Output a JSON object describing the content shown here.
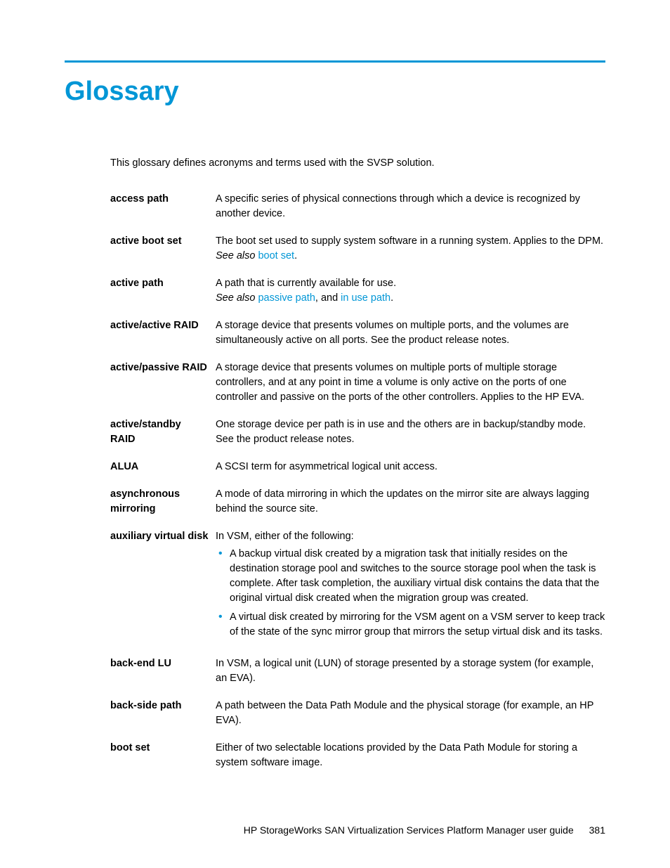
{
  "title": "Glossary",
  "intro": "This glossary defines acronyms and terms used with the SVSP solution.",
  "entries": {
    "access_path": {
      "term": "access path",
      "def": "A specific series of physical connections through which a device is recognized by another device."
    },
    "active_boot_set": {
      "term": "active boot set",
      "def": "The boot set used to supply system software in a running system. Applies to the DPM.",
      "see_also_prefix": "See also ",
      "see_also_link": "boot set",
      "see_also_suffix": "."
    },
    "active_path": {
      "term": "active path",
      "def": "A path that is currently available for use.",
      "see_also_prefix": "See also ",
      "see_also_link1": "passive path",
      "see_also_mid": ", and ",
      "see_also_link2": "in use path",
      "see_also_suffix": "."
    },
    "active_active_raid": {
      "term": "active/active RAID",
      "def": "A storage device that presents volumes on multiple ports, and the volumes are simultaneously active on all ports. See the product release notes."
    },
    "active_passive_raid": {
      "term": "active/passive RAID",
      "def": "A storage device that presents volumes on multiple ports of multiple storage controllers, and at any point in time a volume is only active on the ports of one controller and passive on the ports of the other controllers. Applies to the HP EVA."
    },
    "active_standby_raid": {
      "term": "active/standby RAID",
      "def": "One storage device per path is in use and the others are in backup/standby mode. See the product release notes."
    },
    "alua": {
      "term": "ALUA",
      "def": "A SCSI term for asymmetrical logical unit access."
    },
    "async_mirroring": {
      "term": "asynchronous mirroring",
      "def": "A mode of data mirroring in which the updates on the mirror site are always lagging behind the source site."
    },
    "aux_vdisk": {
      "term": "auxiliary virtual disk",
      "lead": "In VSM, either of the following:",
      "b1": "A backup virtual disk created by a migration task that initially resides on the destination storage pool and switches to the source storage pool when the task is complete. After task completion, the auxiliary virtual disk contains the data that the original virtual disk created when the migration group was created.",
      "b2": "A virtual disk created by mirroring for the VSM agent on a VSM server to keep track of the state of the sync mirror group that mirrors the setup virtual disk and its tasks."
    },
    "back_end_lu": {
      "term": "back-end LU",
      "def": "In VSM, a logical unit (LUN) of storage presented by a storage system (for example, an EVA)."
    },
    "back_side_path": {
      "term": "back-side path",
      "def": "A path between the Data Path Module and the physical storage (for example, an HP EVA)."
    },
    "boot_set": {
      "term": "boot set",
      "def": "Either of two selectable locations provided by the Data Path Module for storing a system software image."
    }
  },
  "footer": {
    "doc": "HP StorageWorks SAN Virtualization Services Platform Manager user guide",
    "page": "381"
  }
}
